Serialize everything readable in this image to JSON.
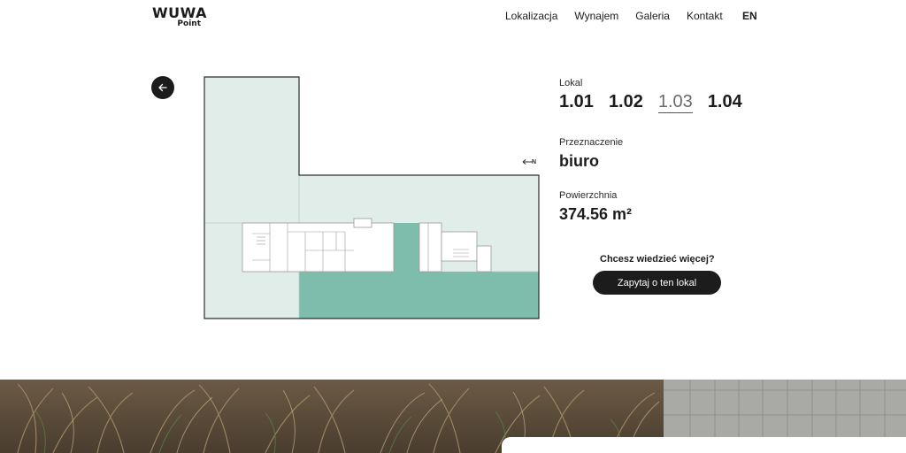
{
  "header": {
    "logo_main": "WUWA",
    "logo_sub": "Point",
    "nav": [
      "Lokalizacja",
      "Wynajem",
      "Galeria",
      "Kontakt"
    ],
    "lang": "EN"
  },
  "plan": {
    "compass_label": "N",
    "colors": {
      "outline": "#2d2d2d",
      "light": "#e1ede9",
      "highlight": "#7ebdab"
    }
  },
  "info": {
    "lokal_label": "Lokal",
    "units": [
      "1.01",
      "1.02",
      "1.03",
      "1.04"
    ],
    "active_unit": "1.03",
    "przeznaczenie_label": "Przeznaczenie",
    "przeznaczenie_value": "biuro",
    "powierzchnia_label": "Powierzchnia",
    "powierzchnia_value": "374.56 m²"
  },
  "cta": {
    "question": "Chcesz wiedzieć więcej?",
    "button": "Zapytaj o ten lokal"
  }
}
